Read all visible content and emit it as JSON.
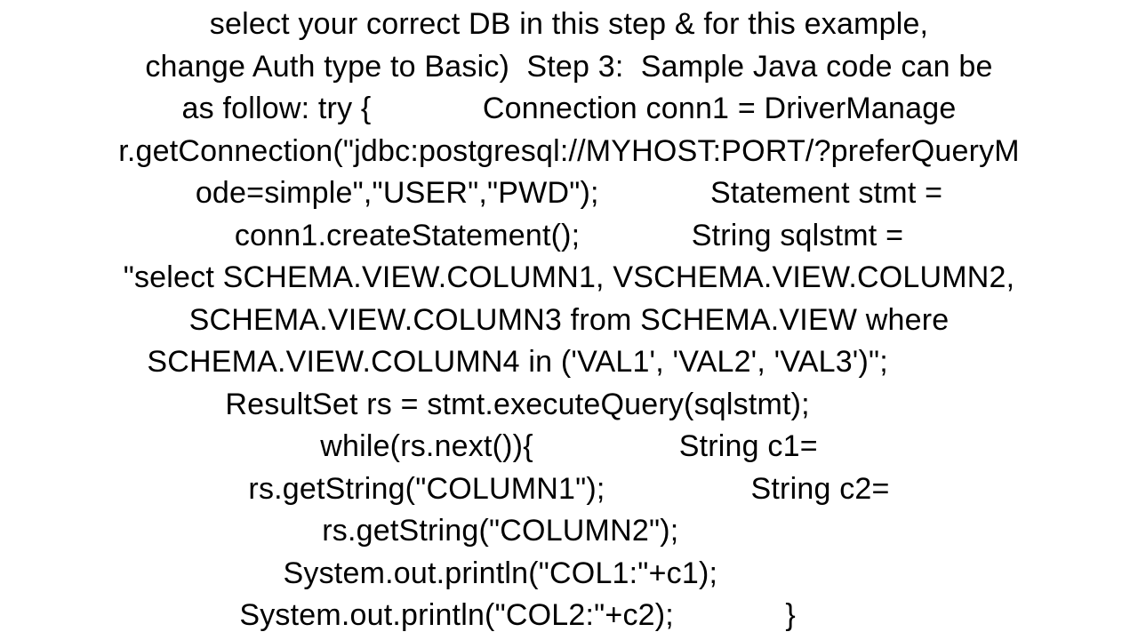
{
  "lines": [
    "select your correct DB in this step & for this example,",
    "change Auth type to Basic)  Step 3:  Sample Java code can be",
    "as follow: try {             Connection conn1 = DriverManage",
    "r.getConnection(\"jdbc:postgresql://MYHOST:PORT/?preferQueryM",
    "ode=simple\",\"USER\",\"PWD\");             Statement stmt =",
    "conn1.createStatement();             String sqlstmt =",
    "\"select SCHEMA.VIEW.COLUMN1, VSCHEMA.VIEW.COLUMN2,",
    "SCHEMA.VIEW.COLUMN3 from SCHEMA.VIEW where",
    "SCHEMA.VIEW.COLUMN4 in ('VAL1', 'VAL2', 'VAL3')\";            ",
    "ResultSet rs = stmt.executeQuery(sqlstmt);            ",
    "while(rs.next()){                 String c1=",
    "rs.getString(\"COLUMN1\");                 String c2=",
    "rs.getString(\"COLUMN2\");                ",
    "System.out.println(\"COL1:\"+c1);                ",
    "System.out.println(\"COL2:\"+c2);             }            "
  ]
}
